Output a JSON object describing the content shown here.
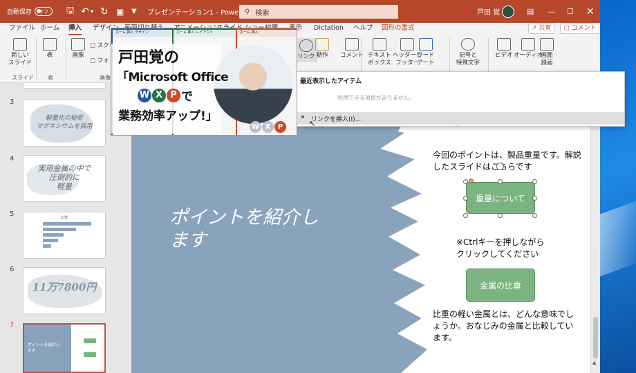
{
  "titlebar": {
    "autosave": "自動保存",
    "autosave_state": "オフ",
    "doc_title": "プレゼンテーション1 - PowerPoint",
    "search_placeholder": "検索",
    "user": "戸田 覚"
  },
  "tabs": [
    "ファイル",
    "ホーム",
    "挿入",
    "デザイン",
    "画面切り替え",
    "アニメーション",
    "スライド ショー",
    "校閲",
    "表示",
    "Dictation",
    "ヘルプ",
    "図形の書式"
  ],
  "active_tab": "挿入",
  "share_label": "共有",
  "comment_label": "コメント",
  "ribbon": {
    "new_slide": "新しい\nスライド",
    "table": "表",
    "images": "画像",
    "screenshot": "スクリ",
    "photo_album": "フォト",
    "link": "リンク",
    "action": "動作",
    "comment": "コメント",
    "textbox": "テキスト\nボックス",
    "header_footer": "ヘッダーと\nフッター",
    "wordart": "ワード\nアート",
    "symbols": "記号と\n特殊文字",
    "video": "ビデオ",
    "audio": "オーディオ",
    "screen_record": "画面\n録画",
    "groups": {
      "slides": "スライド",
      "tables": "表",
      "images": "画像"
    }
  },
  "dropdown": {
    "title": "最近表示したアイテム",
    "empty": "利用できる項目がありません。",
    "insert_link": "リンクを挿入(I)..."
  },
  "ad": {
    "line1": "戸田覚の",
    "line2": "「Microsoft Office",
    "line3": "で",
    "line4": "業務効率アップ!」",
    "w": "W",
    "x": "X",
    "p": "P",
    "shot_tabs": [
      "ホーム",
      "挿入",
      "デザイン",
      "レイアウト"
    ]
  },
  "slides": [
    {
      "num": "3",
      "text": "軽量化の秘密\nマグネシウムを採用"
    },
    {
      "num": "4",
      "text": "実用金属の中で\n圧倒的に\n軽量"
    },
    {
      "num": "5",
      "chart_title": "比重"
    },
    {
      "num": "6",
      "text": "11万7800円"
    },
    {
      "num": "7",
      "text": "ポイントを紹介し\nます"
    }
  ],
  "current_slide": {
    "title": "ポイントを紹介し\nます",
    "body1": "今回のポイントは、製品重量です。解説したスライドはこちらです",
    "button1": "重量について",
    "note": "※Ctrlキーを押しながら\nクリックしてください",
    "button2": "金属の比重",
    "body2": "比重の軽い金属とは、どんな意味でしょうか。おなじみの金属と比較しています。"
  },
  "colors": {
    "brand": "#b7472a",
    "slide_blue": "#8aa3bd",
    "button_green": "#7bb381",
    "word": "#2b579a",
    "excel": "#217346",
    "ppt": "#d24726"
  }
}
